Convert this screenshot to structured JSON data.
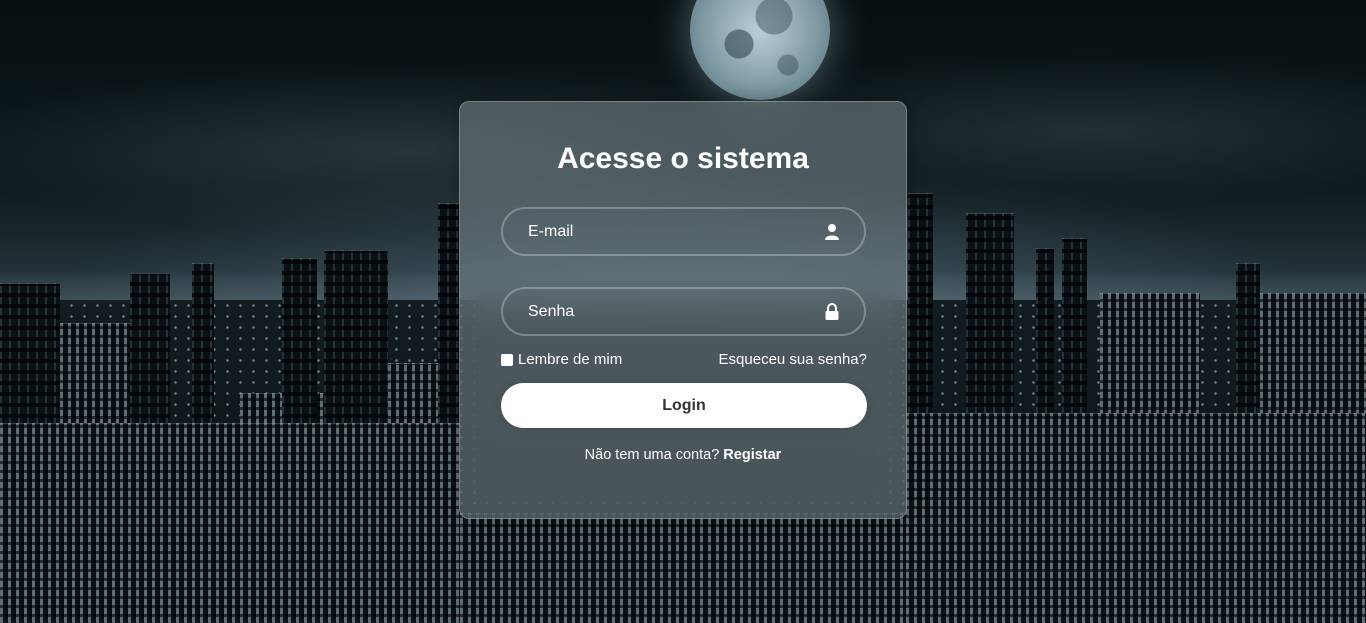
{
  "login": {
    "title": "Acesse o sistema",
    "email": {
      "placeholder": "E-mail",
      "icon": "user-icon"
    },
    "password": {
      "placeholder": "Senha",
      "icon": "lock-icon"
    },
    "remember_label": "Lembre de mim",
    "forgot_label": "Esqueceu sua senha?",
    "login_button": "Login",
    "register_prompt": "Não tem uma conta?",
    "register_link": "Registar"
  },
  "colors": {
    "card_bg": "#7d888c",
    "button_bg": "#ffffff",
    "button_text": "#333333",
    "text": "#ffffff"
  }
}
